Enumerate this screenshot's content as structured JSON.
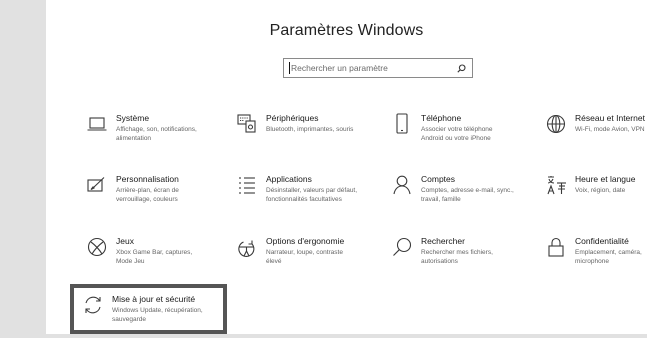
{
  "window": {
    "title": "Paramètres Windows"
  },
  "search": {
    "placeholder": "Rechercher un paramètre",
    "icon": "search-icon"
  },
  "tiles": [
    {
      "id": "systeme",
      "icon": "laptop-icon",
      "title": "Système",
      "desc": "Affichage, son, notifications,\nalimentation"
    },
    {
      "id": "peripheriques",
      "icon": "keyboard-icon",
      "title": "Périphériques",
      "desc": "Bluetooth, imprimantes, souris"
    },
    {
      "id": "telephone",
      "icon": "phone-icon",
      "title": "Téléphone",
      "desc": "Associer votre téléphone\nAndroid ou votre iPhone"
    },
    {
      "id": "reseau",
      "icon": "globe-icon",
      "title": "Réseau et Internet",
      "desc": "Wi-Fi, mode Avion, VPN"
    },
    {
      "id": "personnalisation",
      "icon": "paint-icon",
      "title": "Personnalisation",
      "desc": "Arrière-plan, écran de\nverrouillage, couleurs"
    },
    {
      "id": "applications",
      "icon": "apps-list-icon",
      "title": "Applications",
      "desc": "Désinstaller, valeurs par défaut,\nfonctionnalités facultatives"
    },
    {
      "id": "comptes",
      "icon": "person-icon",
      "title": "Comptes",
      "desc": "Comptes, adresse e-mail, sync.,\ntravail, famille"
    },
    {
      "id": "heure",
      "icon": "language-icon",
      "title": "Heure et langue",
      "desc": "Voix, région, date"
    },
    {
      "id": "jeux",
      "icon": "xbox-icon",
      "title": "Jeux",
      "desc": "Xbox Game Bar, captures,\nMode Jeu"
    },
    {
      "id": "ergonomie",
      "icon": "ease-of-access-icon",
      "title": "Options d'ergonomie",
      "desc": "Narrateur, loupe, contraste\nélevé"
    },
    {
      "id": "rechercher",
      "icon": "magnifier-icon",
      "title": "Rechercher",
      "desc": "Rechercher mes fichiers,\nautorisations"
    },
    {
      "id": "confidentialite",
      "icon": "lock-icon",
      "title": "Confidentialité",
      "desc": "Emplacement, caméra,\nmicrophone"
    },
    {
      "id": "miseajour",
      "icon": "sync-icon",
      "title": "Mise à jour et sécurité",
      "desc": "Windows Update, récupération,\nsauvegarde"
    }
  ],
  "colors": {
    "background": "#ffffff",
    "side_strip": "#e1e1e1",
    "highlight_border": "#555555"
  }
}
